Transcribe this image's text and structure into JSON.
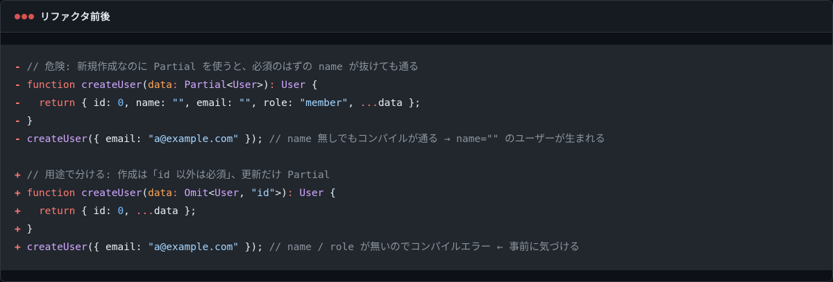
{
  "window": {
    "title": "リファクタ前後",
    "dot_colors": [
      "#d9534f",
      "#d9534f",
      "#d9534f"
    ]
  },
  "code": {
    "lines": [
      {
        "mark": "-",
        "segments": [
          {
            "t": "// 危険: 新規作成なのに Partial を使うと、必須のはずの name が抜けても通る",
            "c": "comment"
          }
        ]
      },
      {
        "mark": "-",
        "segments": [
          {
            "t": "function ",
            "c": "kw"
          },
          {
            "t": "createUser",
            "c": "fn"
          },
          {
            "t": "(",
            "c": "plain"
          },
          {
            "t": "data",
            "c": "param"
          },
          {
            "t": ": ",
            "c": "kw"
          },
          {
            "t": "Partial",
            "c": "type"
          },
          {
            "t": "<",
            "c": "plain"
          },
          {
            "t": "User",
            "c": "type"
          },
          {
            "t": ">)",
            "c": "plain"
          },
          {
            "t": ": ",
            "c": "kw"
          },
          {
            "t": "User",
            "c": "type"
          },
          {
            "t": " {",
            "c": "plain"
          }
        ]
      },
      {
        "mark": "-",
        "segments": [
          {
            "t": "  ",
            "c": "plain"
          },
          {
            "t": "return",
            "c": "kw"
          },
          {
            "t": " { id: ",
            "c": "plain"
          },
          {
            "t": "0",
            "c": "num"
          },
          {
            "t": ", name: ",
            "c": "plain"
          },
          {
            "t": "\"\"",
            "c": "str"
          },
          {
            "t": ", email: ",
            "c": "plain"
          },
          {
            "t": "\"\"",
            "c": "str"
          },
          {
            "t": ", role: ",
            "c": "plain"
          },
          {
            "t": "\"member\"",
            "c": "str"
          },
          {
            "t": ", ",
            "c": "plain"
          },
          {
            "t": "...",
            "c": "spread"
          },
          {
            "t": "data };",
            "c": "plain"
          }
        ]
      },
      {
        "mark": "-",
        "segments": [
          {
            "t": "}",
            "c": "plain"
          }
        ]
      },
      {
        "mark": "-",
        "segments": [
          {
            "t": "createUser",
            "c": "fn"
          },
          {
            "t": "({ email: ",
            "c": "plain"
          },
          {
            "t": "\"a@example.com\"",
            "c": "str"
          },
          {
            "t": " }); ",
            "c": "plain"
          },
          {
            "t": "// name 無しでもコンパイルが通る → name=\"\" のユーザーが生まれる",
            "c": "comment"
          }
        ]
      },
      {
        "mark": "",
        "segments": []
      },
      {
        "mark": "+",
        "segments": [
          {
            "t": "// 用途で分ける: 作成は「id 以外は必須」、更新だけ Partial",
            "c": "comment"
          }
        ]
      },
      {
        "mark": "+",
        "segments": [
          {
            "t": "function ",
            "c": "kw"
          },
          {
            "t": "createUser",
            "c": "fn"
          },
          {
            "t": "(",
            "c": "plain"
          },
          {
            "t": "data",
            "c": "param"
          },
          {
            "t": ": ",
            "c": "kw"
          },
          {
            "t": "Omit",
            "c": "type"
          },
          {
            "t": "<",
            "c": "plain"
          },
          {
            "t": "User",
            "c": "type"
          },
          {
            "t": ", ",
            "c": "plain"
          },
          {
            "t": "\"id\"",
            "c": "str"
          },
          {
            "t": ">)",
            "c": "plain"
          },
          {
            "t": ": ",
            "c": "kw"
          },
          {
            "t": "User",
            "c": "type"
          },
          {
            "t": " {",
            "c": "plain"
          }
        ]
      },
      {
        "mark": "+",
        "segments": [
          {
            "t": "  ",
            "c": "plain"
          },
          {
            "t": "return",
            "c": "kw"
          },
          {
            "t": " { id: ",
            "c": "plain"
          },
          {
            "t": "0",
            "c": "num"
          },
          {
            "t": ", ",
            "c": "plain"
          },
          {
            "t": "...",
            "c": "spread"
          },
          {
            "t": "data };",
            "c": "plain"
          }
        ]
      },
      {
        "mark": "+",
        "segments": [
          {
            "t": "}",
            "c": "plain"
          }
        ]
      },
      {
        "mark": "+",
        "segments": [
          {
            "t": "createUser",
            "c": "fn"
          },
          {
            "t": "({ email: ",
            "c": "plain"
          },
          {
            "t": "\"a@example.com\"",
            "c": "str"
          },
          {
            "t": " }); ",
            "c": "plain"
          },
          {
            "t": "// name / role が無いのでコンパイルエラー ← 事前に気づける",
            "c": "comment"
          }
        ]
      }
    ]
  }
}
